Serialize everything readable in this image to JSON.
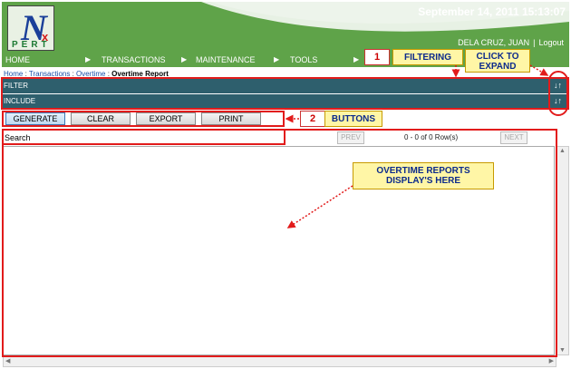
{
  "header": {
    "date_time": "September 14, 2011 15:13:07",
    "user": "DELA CRUZ, JUAN",
    "separator": "|",
    "logout": "Logout",
    "logo_text": "PERT",
    "logo_n": "N",
    "logo_x": "x"
  },
  "nav": {
    "items": [
      {
        "label": "HOME"
      },
      {
        "label": "TRANSACTIONS"
      },
      {
        "label": "MAINTENANCE"
      },
      {
        "label": "TOOLS"
      }
    ],
    "arrow": "▶"
  },
  "breadcrumb": {
    "home": "Home",
    "transactions": "Transactions",
    "overtime": "Overtime",
    "current": "Overtime Report",
    "sep": " : "
  },
  "filters": {
    "filter": "FILTER",
    "include": "INCLUDE",
    "expand_icon": "↓↑"
  },
  "buttons": {
    "generate": "GENERATE",
    "clear": "CLEAR",
    "export": "EXPORT",
    "print": "PRINT"
  },
  "search": {
    "label": "Search",
    "prev": "PREV",
    "next": "NEXT",
    "row_count": "0 - 0 of 0 Row(s)"
  },
  "annotations": {
    "filtering_num": "1",
    "filtering_label": "FILTERING",
    "click_expand": "CLICK TO EXPAND",
    "buttons_num": "2",
    "buttons_label": "BUTTONS",
    "reports_label": "OVERTIME REPORTS DISPLAY'S HERE"
  },
  "colors": {
    "header_green": "#5fa349",
    "bar_teal": "#2e5f6d",
    "annotation_red": "#e21b1b",
    "callout_yellow": "#fff6a6"
  }
}
